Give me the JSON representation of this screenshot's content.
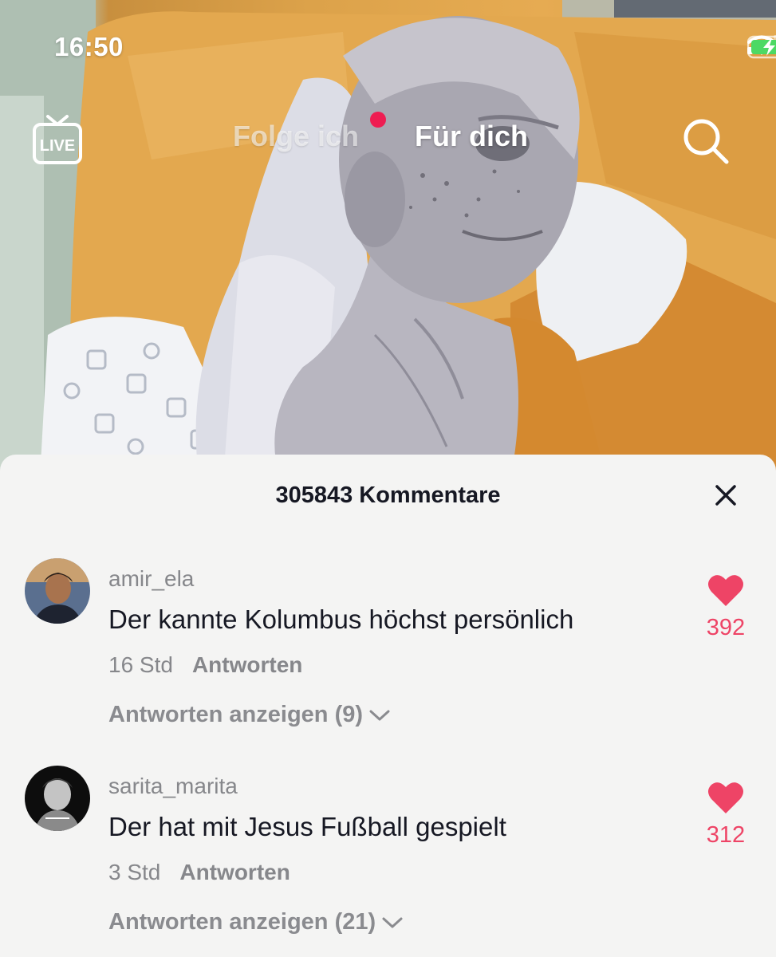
{
  "status_bar": {
    "time": "16:50"
  },
  "top_nav": {
    "live_label": "LIVE",
    "tab_following": "Folge ich",
    "tab_for_you": "Für dich"
  },
  "comments_panel": {
    "title": "305843 Kommentare",
    "comments": [
      {
        "username": "amir_ela",
        "text": "Der kannte Kolumbus höchst persönlich",
        "time": "16 Std",
        "reply_label": "Antworten",
        "view_replies": "Antworten anzeigen (9)",
        "likes": "392"
      },
      {
        "username": "sarita_marita",
        "text": "Der hat mit Jesus Fußball gespielt",
        "time": "3 Std",
        "reply_label": "Antworten",
        "view_replies": "Antworten anzeigen (21)",
        "likes": "312"
      }
    ]
  },
  "colors": {
    "like_red": "#ee4466",
    "notification_dot": "#ee1d52",
    "sheet_background": "#f4f4f3",
    "text_primary": "#161823",
    "text_secondary": "#86878b"
  },
  "icons": [
    "live-tv-icon",
    "search-icon",
    "close-icon",
    "heart-icon",
    "chevron-down-icon",
    "signal-icon",
    "wifi-icon",
    "battery-charging-icon"
  ]
}
